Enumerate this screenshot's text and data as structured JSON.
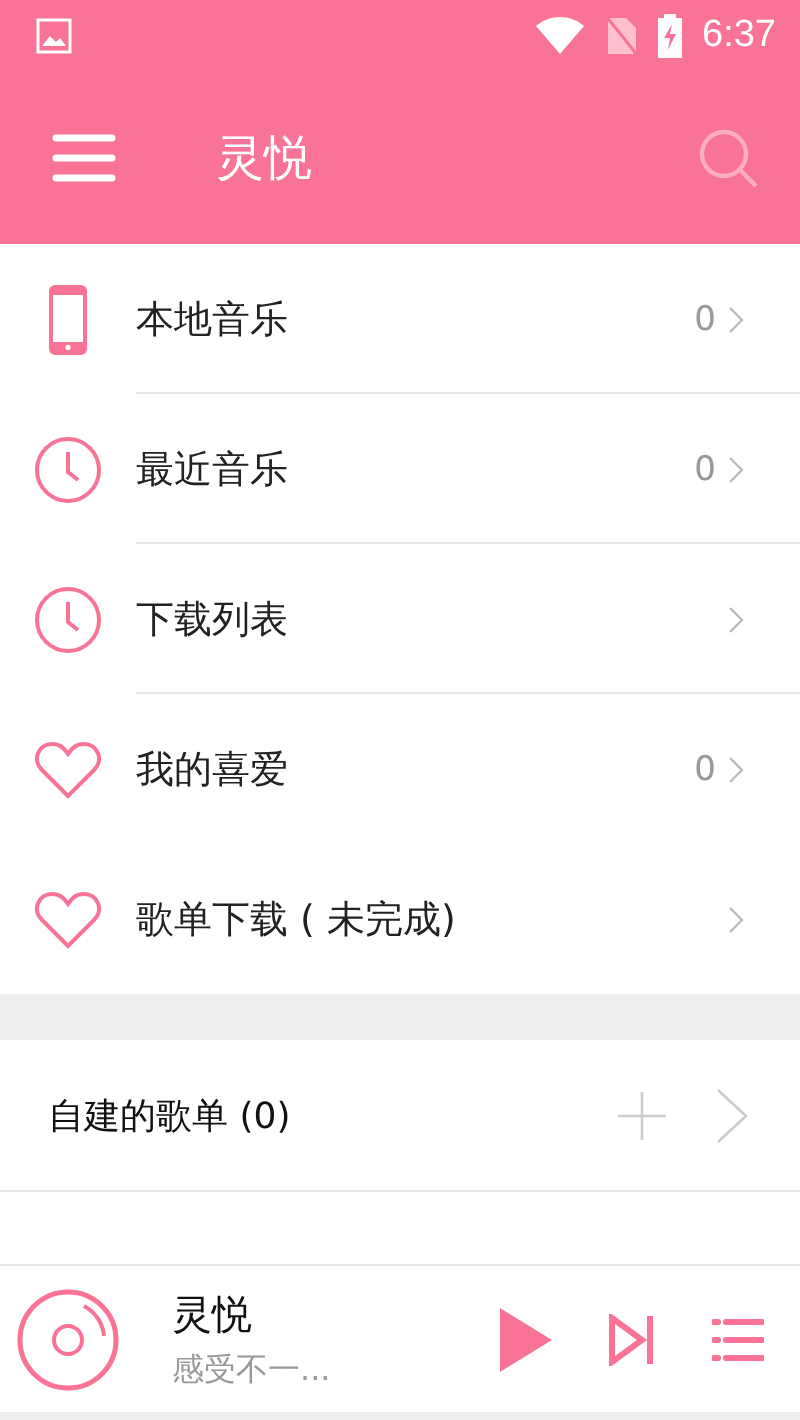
{
  "status_bar": {
    "time": "6:37"
  },
  "toolbar": {
    "title": "灵悦"
  },
  "menu": [
    {
      "kind": "phone",
      "label": "本地音乐",
      "count": "0"
    },
    {
      "kind": "clock",
      "label": "最近音乐",
      "count": "0"
    },
    {
      "kind": "clock",
      "label": "下载列表"
    },
    {
      "kind": "heart",
      "label": "我的喜爱",
      "count": "0"
    },
    {
      "kind": "heart",
      "label": "歌单下载 ( 未完成)"
    }
  ],
  "playlists": {
    "label": "自建的歌单 (0)"
  },
  "player": {
    "title": "灵悦",
    "subtitle": "感受不一..."
  }
}
